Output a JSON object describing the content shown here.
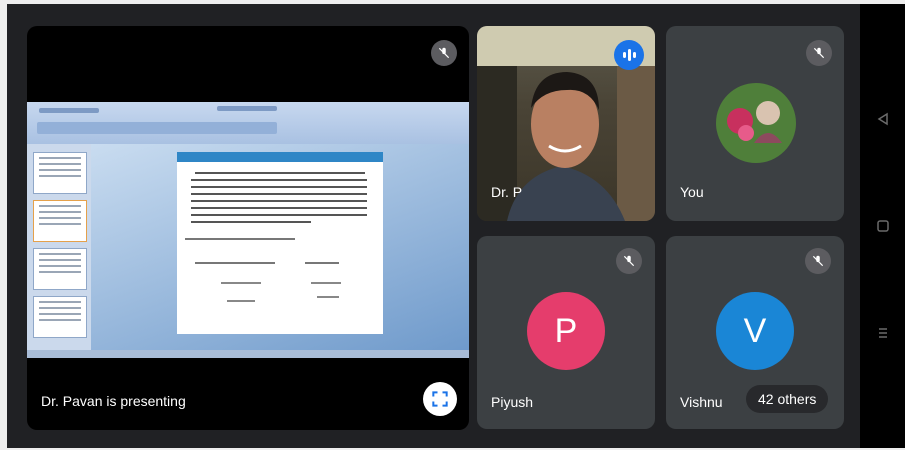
{
  "presentation": {
    "caption": "Dr. Pavan is presenting",
    "fullscreen_icon": "fullscreen-icon",
    "mic_icon": "mic-off-icon"
  },
  "participants": [
    {
      "name": "Dr. P",
      "type": "video",
      "status_icon": "speaking-indicator-icon"
    },
    {
      "name": "You",
      "type": "photo-avatar",
      "status_icon": "mic-off-icon"
    },
    {
      "name": "Piyush",
      "type": "letter-avatar",
      "initial": "P",
      "color": "#e53d6c",
      "status_icon": "mic-off-icon"
    },
    {
      "name": "Vishnu",
      "type": "letter-avatar",
      "initial": "V",
      "color": "#1a86d6",
      "status_icon": "mic-off-icon"
    }
  ],
  "others_badge": "42 others",
  "nav": {
    "back_icon": "back-triangle-icon",
    "home_icon": "home-square-icon",
    "recents_icon": "recents-lines-icon"
  },
  "colors": {
    "background": "#202124",
    "tile": "#3c4043",
    "speaking": "#1a73e8"
  }
}
